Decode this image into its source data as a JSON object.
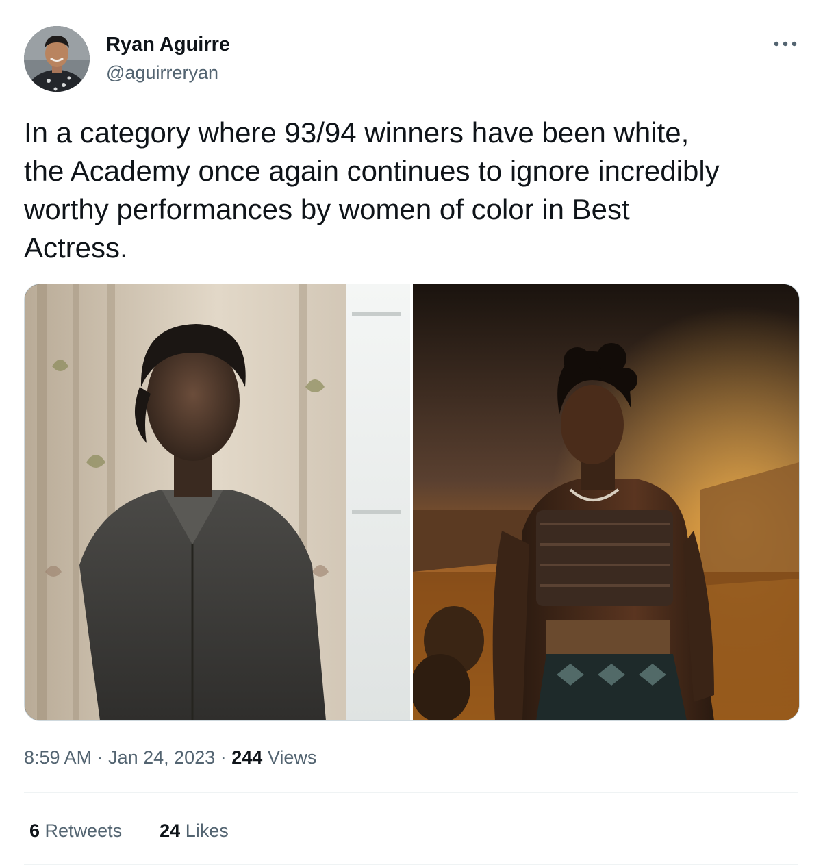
{
  "author": {
    "display_name": "Ryan Aguirre",
    "handle": "@aguirreryan"
  },
  "tweet": {
    "text": "In a category where 93/94 winners have been white,\nthe Academy once again continues to ignore incredibly\nworthy performances by women of color in Best\nActress.",
    "time": "8:59 AM",
    "date": "Jan 24, 2023",
    "separator": "·",
    "views_count": "244",
    "views_label": "Views"
  },
  "stats": {
    "retweets_count": "6",
    "retweets_label": "Retweets",
    "likes_count": "24",
    "likes_label": "Likes"
  },
  "icons": {
    "more": "more-horizontal-icon"
  },
  "colors": {
    "text_primary": "#0f1419",
    "text_secondary": "#536471",
    "border": "#cfd9de",
    "divider": "#eff3f4"
  }
}
